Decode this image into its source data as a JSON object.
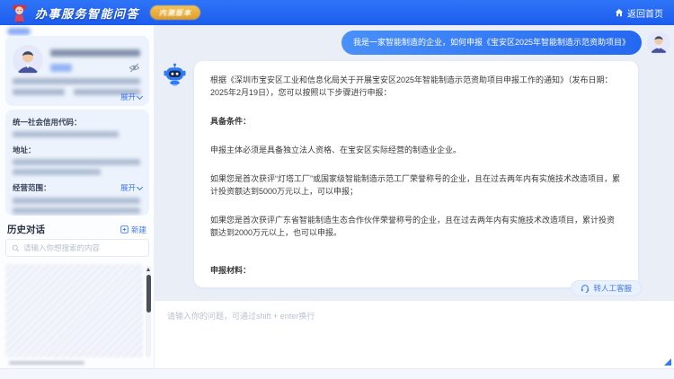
{
  "header": {
    "title": "办事服务智能问答",
    "badge_label": "内测版本",
    "home_label": "返回首页"
  },
  "sidebar": {
    "company_card": {
      "expand_label": "展开"
    },
    "info_card": {
      "credit_code_label": "统一社会信用代码：",
      "address_label": "地址：",
      "scope_label": "经营范围：",
      "scope_expand_label": "展开"
    },
    "history": {
      "title": "历史对话",
      "new_label": "新建",
      "search_placeholder": "请输入你想搜索的内容"
    }
  },
  "chat": {
    "user_message": "我是一家智能制造的企业，如何申报《宝安区2025年智能制造示范资助项目》",
    "bot": {
      "paragraphs": [
        "根据《深圳市宝安区工业和信息化局关于开展宝安区2025年智能制造示范资助项目申报工作的通知》（发布日期：2025年2月19日），您可以按照以下步骤进行申报：",
        "具备条件：",
        "申报主体必须是具备独立法人资格、在宝安区实际经营的制造业企业。",
        "如果您是首次获评“灯塔工厂”或国家级智能制造示范工厂荣誉称号的企业，且在过去两年内有实施技术改造项目，累计投资额达到5000万元以上，可以申报；",
        "如果您是首次获评广东省智能制造生态合作伙伴荣誉称号的企业，且在过去两年内有实施技术改造项目，累计投资额达到2000万元以上，也可以申报。",
        "申报材料："
      ]
    },
    "transfer_label": "转人工客服"
  },
  "composer": {
    "placeholder": "请输入你的问题，可通过shift + enter换行"
  },
  "colors": {
    "header_blue": "#2166f1",
    "accent_blue": "#3a78f2",
    "user_bubble_blue": "#2f7bf5",
    "badge_gold": "#e8a93e",
    "chat_background": "#e9eef7",
    "card_background": "#edf3fd"
  }
}
